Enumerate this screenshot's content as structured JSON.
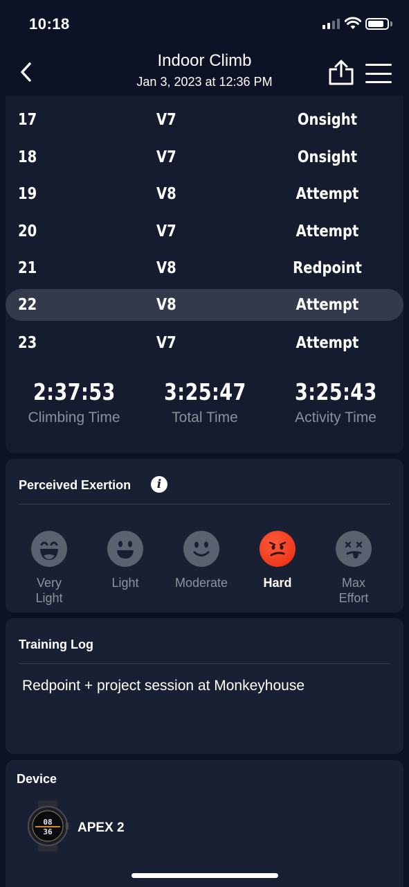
{
  "status_bar": {
    "time": "10:18"
  },
  "header": {
    "title": "Indoor Climb",
    "subtitle": "Jan 3, 2023 at 12:36 PM"
  },
  "climbs": [
    {
      "num": "17",
      "grade": "V7",
      "type": "Onsight"
    },
    {
      "num": "18",
      "grade": "V7",
      "type": "Onsight"
    },
    {
      "num": "19",
      "grade": "V8",
      "type": "Attempt"
    },
    {
      "num": "20",
      "grade": "V7",
      "type": "Attempt"
    },
    {
      "num": "21",
      "grade": "V8",
      "type": "Redpoint"
    },
    {
      "num": "22",
      "grade": "V8",
      "type": "Attempt"
    },
    {
      "num": "23",
      "grade": "V7",
      "type": "Attempt"
    }
  ],
  "stats": [
    {
      "value": "2:37:53",
      "label": "Climbing Time"
    },
    {
      "value": "3:25:47",
      "label": "Total Time"
    },
    {
      "value": "3:25:43",
      "label": "Activity Time"
    }
  ],
  "exertion": {
    "title": "Perceived Exertion",
    "info_icon": "i",
    "options": [
      {
        "label_line1": "Very",
        "label_line2": "Light",
        "icon": "very-light-face-icon"
      },
      {
        "label_line1": "Light",
        "label_line2": "",
        "icon": "light-face-icon"
      },
      {
        "label_line1": "Moderate",
        "label_line2": "",
        "icon": "moderate-face-icon"
      },
      {
        "label_line1": "Hard",
        "label_line2": "",
        "icon": "hard-face-icon"
      },
      {
        "label_line1": "Max",
        "label_line2": "Effort",
        "icon": "max-effort-face-icon"
      }
    ],
    "selected": "Hard",
    "accent": "#e8361a"
  },
  "training_log": {
    "title": "Training Log",
    "text": "Redpoint + project session at Monkeyhouse"
  },
  "device": {
    "title": "Device",
    "name": "APEX 2",
    "watch_face_top": "08",
    "watch_face_bottom": "36"
  }
}
